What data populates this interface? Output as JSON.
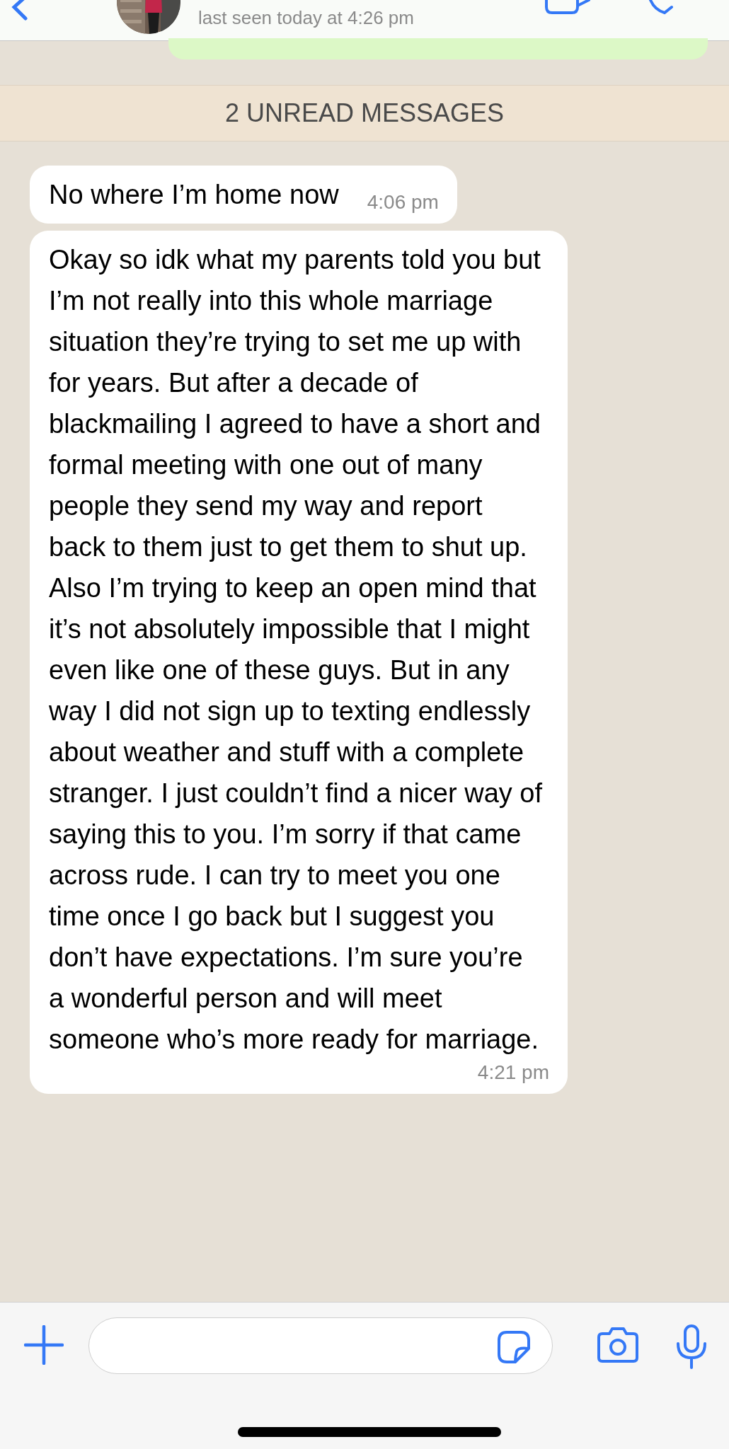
{
  "header": {
    "status": "last seen today at 4:26 pm"
  },
  "unread_banner": "2 UNREAD MESSAGES",
  "messages": [
    {
      "text": "No where I’m home now",
      "time": "4:06 pm"
    },
    {
      "text": "Okay so idk what my parents told you but I’m not really into this whole marriage situation they’re trying to set me up with for years. But after a decade of blackmailing I agreed to have a short and formal meeting with one out of many people they send my way and report back to them just to get them to shut up. Also I’m trying to keep an open mind that it’s not absolutely impossible that I might even like one of these guys. But in any way I did not sign up to texting endlessly about weather and stuff with a complete stranger. I just couldn’t find a nicer way of saying this to you. I’m sorry if that came across rude. I can try to meet you one time once I go back but I suggest you don’t have expectations. I’m sure you’re a wonderful person and will meet someone who’s more ready for marriage.",
      "time": "4:21 pm"
    }
  ]
}
